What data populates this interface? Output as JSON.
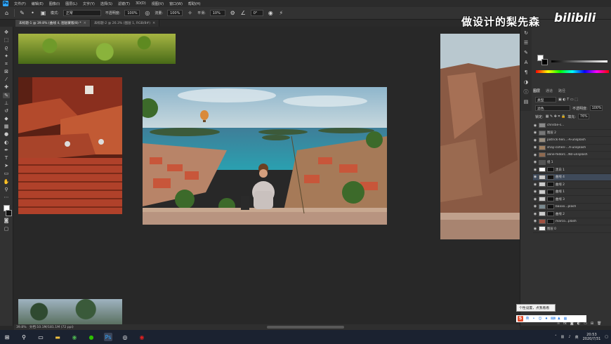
{
  "menubar": {
    "logo": "Ps",
    "items": [
      "文件(F)",
      "编辑(E)",
      "图像(I)",
      "图层(L)",
      "文字(Y)",
      "选择(S)",
      "滤镜(T)",
      "3D(D)",
      "视图(V)",
      "窗口(W)",
      "帮助(H)"
    ]
  },
  "options": {
    "mode_label": "模式:",
    "mode_value": "正常",
    "opacity_label": "不透明度:",
    "opacity_value": "100%",
    "flow_label": "流量:",
    "flow_value": "100%",
    "smooth_label": "平滑:",
    "smooth_value": "10%",
    "angle_value": "0°"
  },
  "tabs": [
    {
      "label": "未标题-1 @ 39.8% (曲线 4, 图层蒙版/8) *",
      "active": true
    },
    {
      "label": "未标题-2 @ 26.3% (图层 1, RGB/8#)",
      "active": false
    }
  ],
  "watermark": {
    "text": "做设计的梨先森",
    "brand": "bilibili"
  },
  "panels": {
    "tabs": [
      "图层",
      "通道",
      "路径"
    ],
    "kind_label": "类型",
    "blend_mode": "滤色",
    "opacity_label": "不透明度:",
    "opacity_value": "100%",
    "lock_label": "锁定:",
    "fill_label": "填充:",
    "fill_value": "76%"
  },
  "layers": [
    {
      "name": "christie-s...",
      "selected": false,
      "thumb": "#8a8a8a",
      "has_mask": false
    },
    {
      "name": "图层 2",
      "selected": false,
      "thumb": "#777",
      "has_mask": false
    },
    {
      "name": "patrick-hen...-A-unsplash",
      "selected": false,
      "thumb": "#9a8f80",
      "has_mask": false
    },
    {
      "name": "shay-cohen-...A-unsplash",
      "selected": false,
      "thumb": "#a08060",
      "has_mask": false
    },
    {
      "name": "aline-fedorc...N0-unsplash",
      "selected": false,
      "thumb": "#8f6a50",
      "has_mask": false
    },
    {
      "name": "组 1",
      "selected": false,
      "thumb": "#555",
      "has_mask": false
    },
    {
      "name": "黑白 1",
      "selected": false,
      "thumb": "#fff",
      "has_mask": true
    },
    {
      "name": "曲线 4",
      "selected": true,
      "thumb": "#ccc",
      "has_mask": true
    },
    {
      "name": "曲线 2",
      "selected": false,
      "thumb": "#ccc",
      "has_mask": true
    },
    {
      "name": "曲线 1",
      "selected": false,
      "thumb": "#ccc",
      "has_mask": true
    },
    {
      "name": "曲线 3",
      "selected": false,
      "thumb": "#ccc",
      "has_mask": true
    },
    {
      "name": "baxxx...plash",
      "selected": false,
      "thumb": "#7a8a90",
      "has_mask": true
    },
    {
      "name": "曲线 2",
      "selected": false,
      "thumb": "#ccc",
      "has_mask": true
    },
    {
      "name": "marco...plash",
      "selected": false,
      "thumb": "#a05040",
      "has_mask": true
    },
    {
      "name": "图层 0",
      "selected": false,
      "thumb": "#eee",
      "has_mask": false
    }
  ],
  "tooltip": "个性设置，点我看看",
  "status": {
    "zoom": "39.8%",
    "doc": "文档:10.1M/181.1M (72 ppi)"
  },
  "taskbar": {
    "time": "20:53",
    "date": "2020/7/31"
  },
  "colors": {
    "accent": "#31a8ff",
    "selection": "#3f4a5a"
  }
}
